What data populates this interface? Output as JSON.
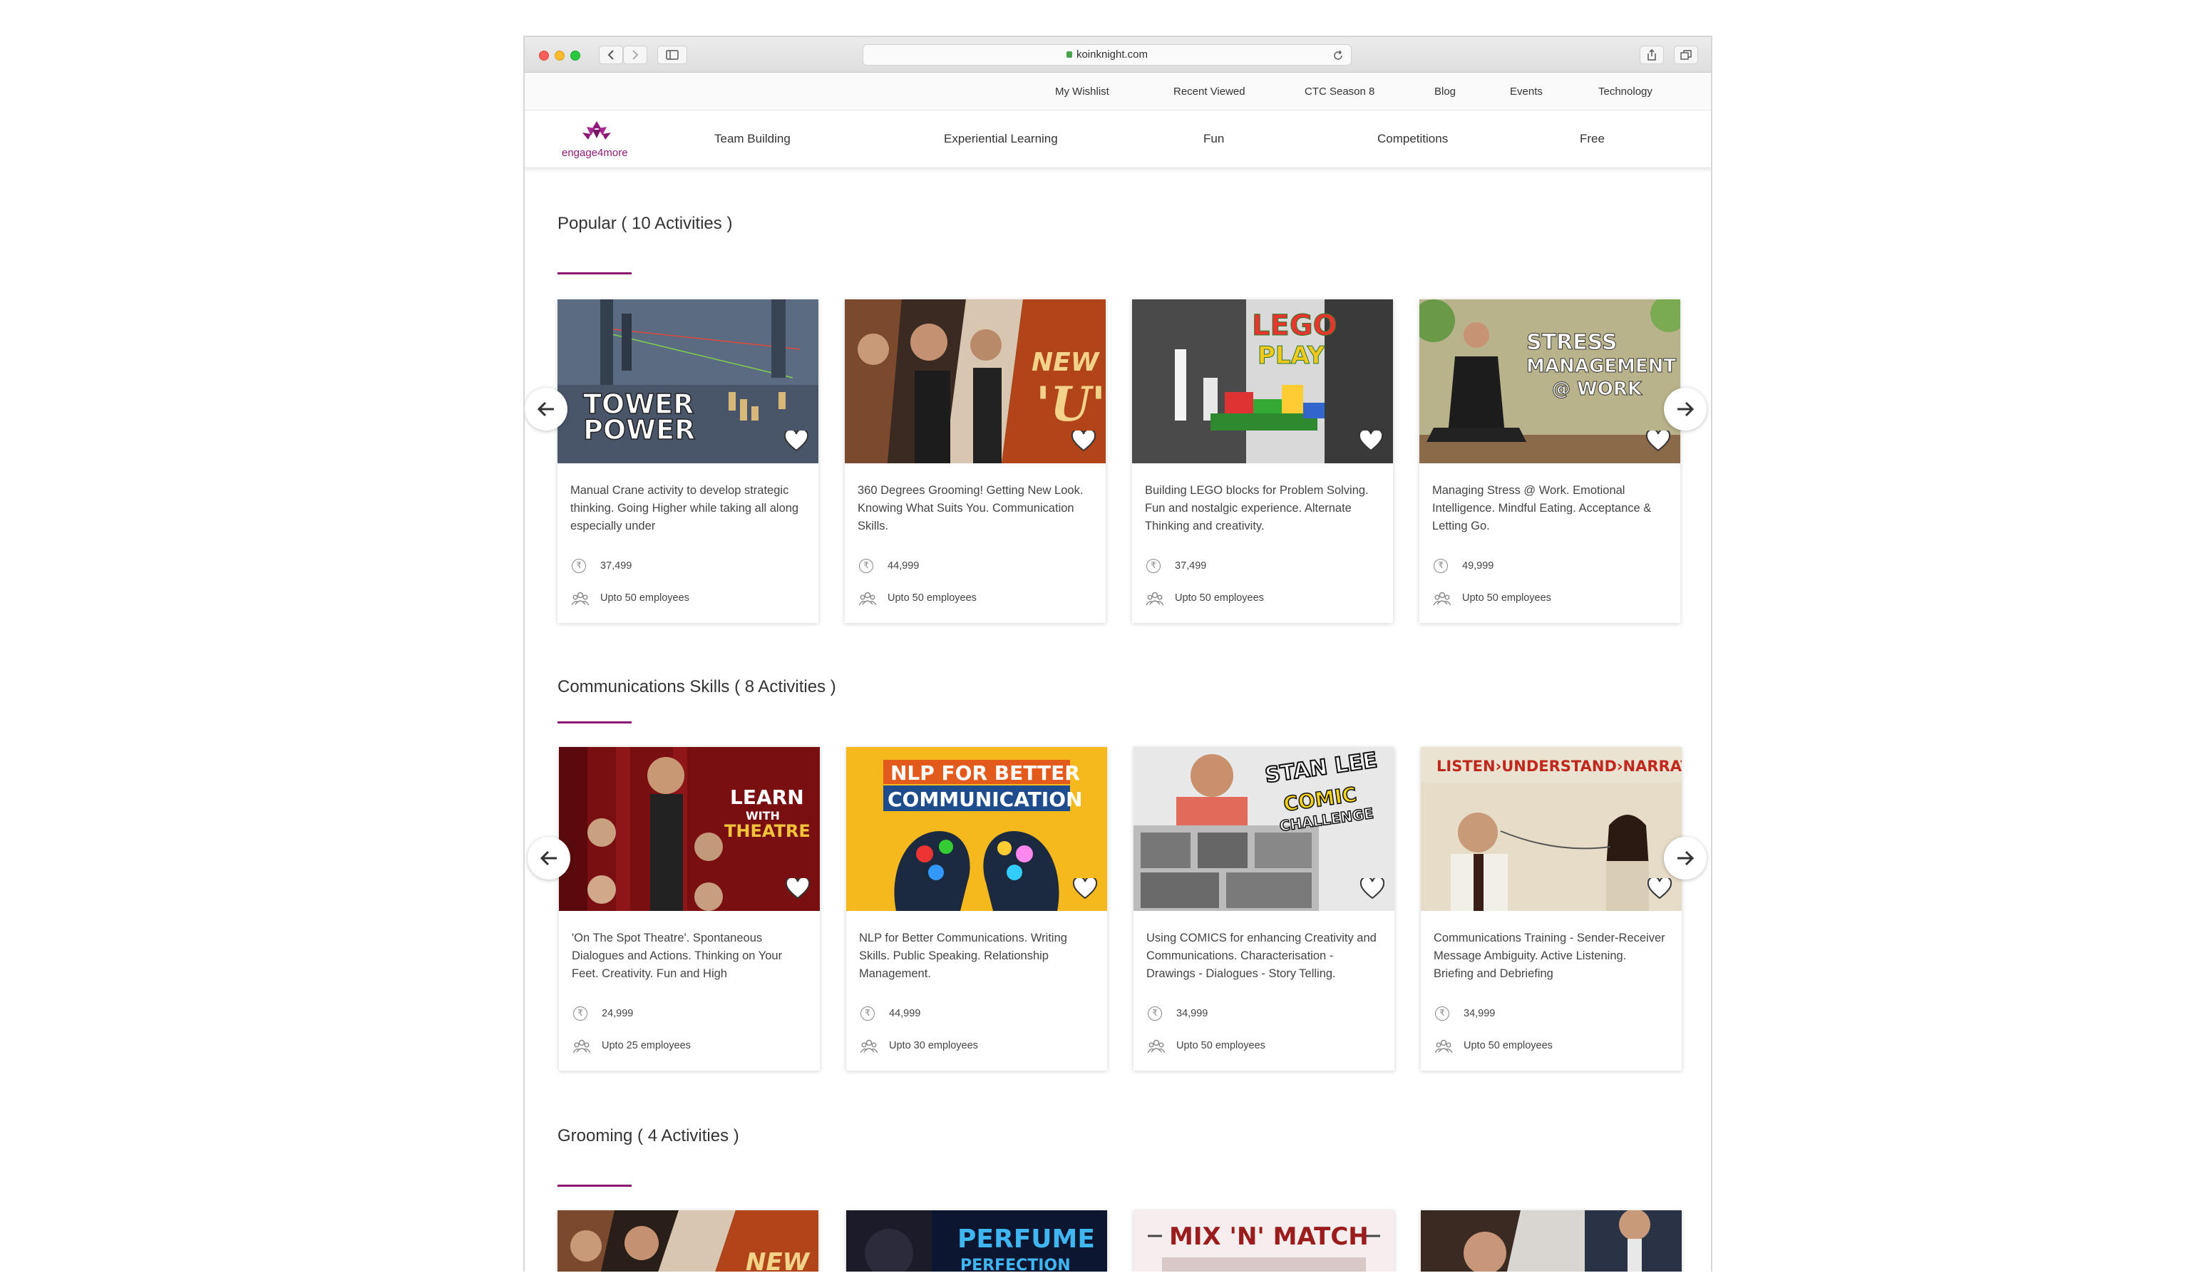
{
  "browser": {
    "url": "koinknight.com"
  },
  "top_links": [
    "My Wishlist",
    "Recent Viewed",
    "CTC Season 8",
    "Blog",
    "Events",
    "Technology"
  ],
  "logo": {
    "text": "engage4more",
    "brand_color": "#8c1a75"
  },
  "main_nav": [
    "Team Building",
    "Experiential Learning",
    "Fun",
    "Competitions",
    "Free"
  ],
  "sections": [
    {
      "title": "Popular ( 10 Activities )",
      "cards": [
        {
          "image_text": "TOWER POWER",
          "description": "Manual Crane activity to develop strategic thinking. Going Higher while taking all along especially under",
          "price": "37,499",
          "employees": "Upto 50 employees"
        },
        {
          "image_text": "NEW 'U'",
          "description": "360 Degrees Grooming! Getting New Look. Knowing What Suits You. Communication Skills.",
          "price": "44,999",
          "employees": "Upto 50 employees"
        },
        {
          "image_text": "LEGO PLAY",
          "description": "Building LEGO blocks for Problem Solving. Fun and nostalgic experience. Alternate Thinking and creativity.",
          "price": "37,499",
          "employees": "Upto 50 employees"
        },
        {
          "image_text": "STRESS MANAGEMENT @ WORK",
          "description": "Managing Stress @ Work. Emotional Intelligence. Mindful Eating. Acceptance & Letting Go.",
          "price": "49,999",
          "employees": "Upto 50 employees"
        }
      ]
    },
    {
      "title": "Communications Skills ( 8 Activities )",
      "cards": [
        {
          "image_text": "LEARN WITH THEATRE",
          "description": "'On The Spot Theatre'. Spontaneous Dialogues and Actions. Thinking on Your Feet. Creativity. Fun and High",
          "price": "24,999",
          "employees": "Upto 25 employees"
        },
        {
          "image_text": "NLP FOR BETTER COMMUNICATION",
          "description": "NLP for Better Communications. Writing Skills. Public Speaking. Relationship Management.",
          "price": "44,999",
          "employees": "Upto 30 employees"
        },
        {
          "image_text": "STAN LEE COMIC CHALLENGE",
          "description": "Using COMICS for enhancing Creativity and Communications. Characterisation - Drawings - Dialogues - Story Telling.",
          "price": "34,999",
          "employees": "Upto 50 employees"
        },
        {
          "image_text": "LISTEN › UNDERSTAND › NARRATE",
          "description": "Communications Training - Sender-Receiver Message Ambiguity. Active Listening. Briefing and Debriefing",
          "price": "34,999",
          "employees": "Upto 50 employees"
        }
      ]
    },
    {
      "title": "Grooming ( 4 Activities )",
      "cards": [
        {
          "image_text": "NEW"
        },
        {
          "image_text": "PERFUME PERFECTION"
        },
        {
          "image_text": "MIX 'N' MATCH"
        },
        {
          "image_text": ""
        }
      ]
    }
  ]
}
